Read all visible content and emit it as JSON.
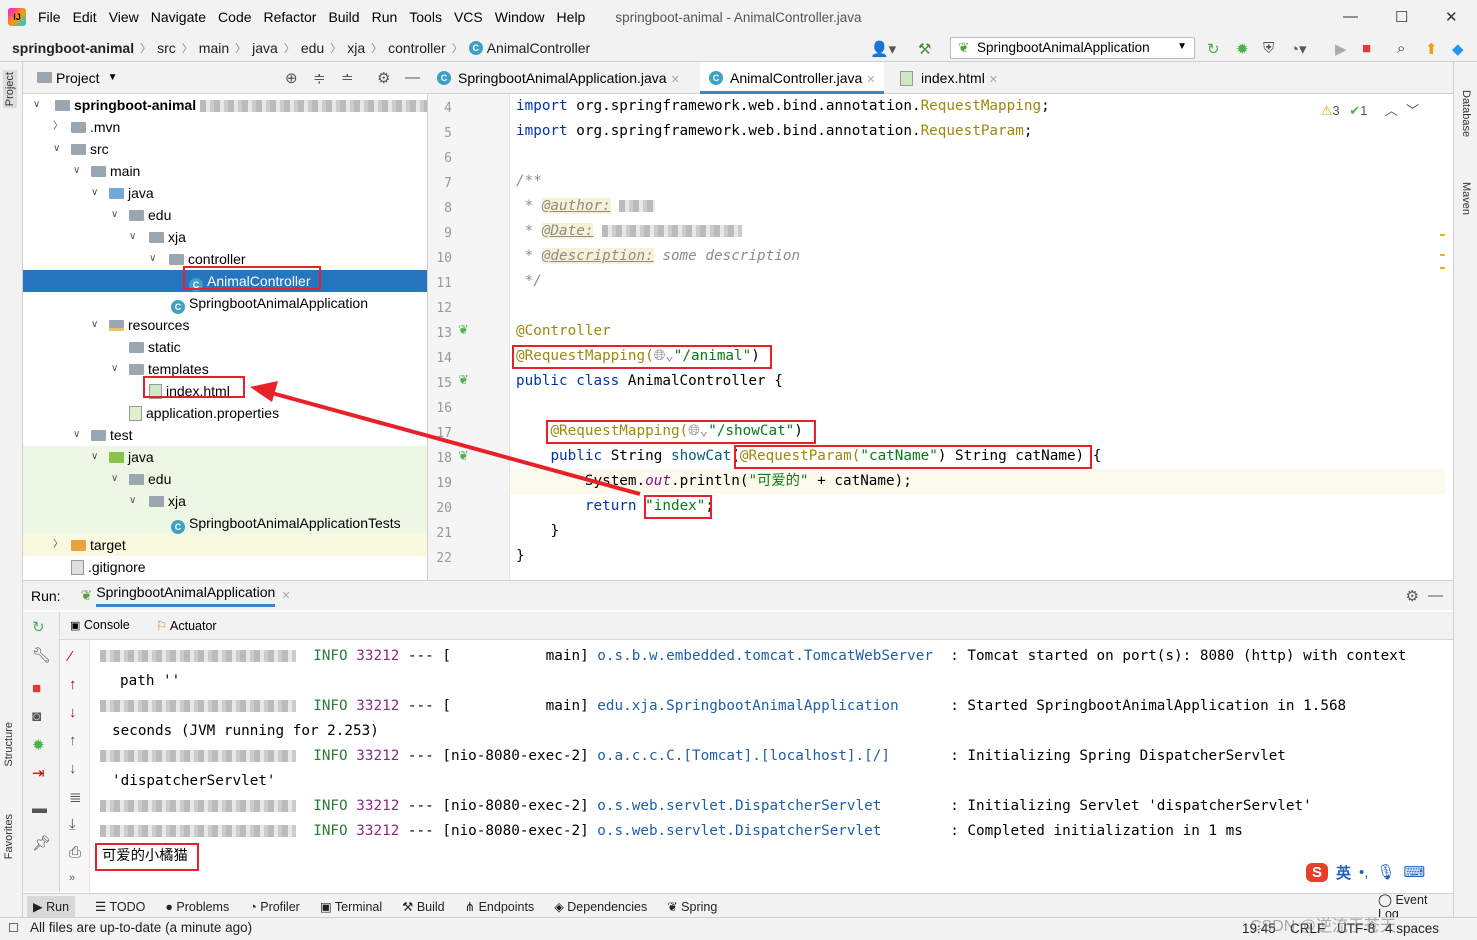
{
  "menubar": {
    "logo": "IJ",
    "items": [
      "File",
      "Edit",
      "View",
      "Navigate",
      "Code",
      "Refactor",
      "Build",
      "Run",
      "Tools",
      "VCS",
      "Window",
      "Help"
    ],
    "title": "springboot-animal - AnimalController.java"
  },
  "breadcrumb": [
    "springboot-animal",
    "src",
    "main",
    "java",
    "edu",
    "xja",
    "controller",
    "AnimalController"
  ],
  "toolbar": {
    "run_config": "SpringbootAnimalApplication"
  },
  "side_labels": {
    "project": "Project",
    "structure": "Structure",
    "favorites": "Favorites",
    "database": "Database",
    "maven": "Maven"
  },
  "project_panel": {
    "title": "Project",
    "tree": [
      {
        "label": "springboot-animal",
        "bold": true
      },
      {
        "label": ".mvn"
      },
      {
        "label": "src"
      },
      {
        "label": "main"
      },
      {
        "label": "java"
      },
      {
        "label": "edu"
      },
      {
        "label": "xja"
      },
      {
        "label": "controller"
      },
      {
        "label": "AnimalController",
        "selected": true
      },
      {
        "label": "SpringbootAnimalApplication"
      },
      {
        "label": "resources"
      },
      {
        "label": "static"
      },
      {
        "label": "templates"
      },
      {
        "label": "index.html"
      },
      {
        "label": "application.properties"
      },
      {
        "label": "test"
      },
      {
        "label": "java"
      },
      {
        "label": "edu"
      },
      {
        "label": "xja"
      },
      {
        "label": "SpringbootAnimalApplicationTests"
      },
      {
        "label": "target"
      },
      {
        "label": ".gitignore"
      }
    ]
  },
  "editor_tabs": [
    "SpringbootAnimalApplication.java",
    "AnimalController.java",
    "index.html"
  ],
  "inspections": {
    "warnings": "3",
    "ok": "1"
  },
  "code": {
    "line_numbers": [
      "4",
      "5",
      "6",
      "7",
      "8",
      "9",
      "10",
      "11",
      "12",
      "13",
      "14",
      "15",
      "16",
      "17",
      "18",
      "19",
      "20",
      "21",
      "22"
    ],
    "l4_kw": "import",
    "l4_pkg": " org.springframework.web.bind.annotation.",
    "l4_cls": "RequestMapping",
    "l4_end": ";",
    "l5_kw": "import",
    "l5_pkg": " org.springframework.web.bind.annotation.",
    "l5_cls": "RequestParam",
    "l5_end": ";",
    "l7": "/**",
    "l8_pre": " * ",
    "l8_tag": "@author:",
    "l9_pre": " * ",
    "l9_tag": "@Date:",
    "l10_pre": " * ",
    "l10_tag": "@description:",
    "l10_text": " some description",
    "l11": " */",
    "l13": "@Controller",
    "l14_ann": "@RequestMapping(",
    "l14_str": "\"/animal\"",
    "l14_end": ")",
    "l15_kw": "public class",
    "l15_rest": " AnimalController {",
    "l17_ann": "@RequestMapping(",
    "l17_str": "\"/showCat\"",
    "l17_end": ")",
    "l18_kw": "public",
    "l18_a": " String ",
    "l18_fn": "showCat",
    "l18_p": "(",
    "l18_ann": "@RequestParam(",
    "l18_str": "\"catName\"",
    "l18_b": ") String catName)",
    "l18_end": " {",
    "l19_a": "System.",
    "l19_out": "out",
    "l19_b": ".println(",
    "l19_str": "\"可爱的\"",
    "l19_c": " + catName);",
    "l20_kw": "return",
    "l20_str": "\"index\"",
    "l20_end": ";",
    "l21": "}",
    "l22": "}"
  },
  "run_panel": {
    "label": "Run:",
    "config": "SpringbootAnimalApplication",
    "tabs": [
      "Console",
      "Actuator"
    ],
    "lines": [
      {
        "level": "INFO",
        "pid": "33212",
        "sep": "---",
        "thread": "[           main]",
        "logger": "o.s.b.w.embedded.tomcat.TomcatWebServer",
        "msg": ": Tomcat started on port(s): 8080 (http) with context"
      },
      {
        "cont": "path ''"
      },
      {
        "level": "INFO",
        "pid": "33212",
        "sep": "---",
        "thread": "[           main]",
        "logger": "edu.xja.SpringbootAnimalApplication",
        "msg": ": Started SpringbootAnimalApplication in 1.568"
      },
      {
        "cont": "seconds (JVM running for 2.253)"
      },
      {
        "level": "INFO",
        "pid": "33212",
        "sep": "---",
        "thread": "[nio-8080-exec-2]",
        "logger": "o.a.c.c.C.[Tomcat].[localhost].[/]",
        "msg": ": Initializing Spring DispatcherServlet"
      },
      {
        "cont": "'dispatcherServlet'"
      },
      {
        "level": "INFO",
        "pid": "33212",
        "sep": "---",
        "thread": "[nio-8080-exec-2]",
        "logger": "o.s.web.servlet.DispatcherServlet",
        "msg": ": Initializing Servlet 'dispatcherServlet'"
      },
      {
        "level": "INFO",
        "pid": "33212",
        "sep": "---",
        "thread": "[nio-8080-exec-2]",
        "logger": "o.s.web.servlet.DispatcherServlet",
        "msg": ": Completed initialization in 1 ms"
      }
    ],
    "output": "可爱的小橘猫"
  },
  "bottom_tabs": [
    "Run",
    "TODO",
    "Problems",
    "Profiler",
    "Terminal",
    "Build",
    "Endpoints",
    "Dependencies",
    "Spring",
    "Event Log"
  ],
  "status": {
    "message": "All files are up-to-date (a minute ago)",
    "position": "19:45",
    "line_sep": "CRLF",
    "encoding": "UTF-8",
    "indent": "4 spaces"
  },
  "ime": {
    "lang": "英"
  },
  "watermark": "CSDN @逆流于苍天",
  "colors": {
    "selection": "#2675bf",
    "highlight_box": "#e8202a",
    "arrow": "#e8202a"
  }
}
